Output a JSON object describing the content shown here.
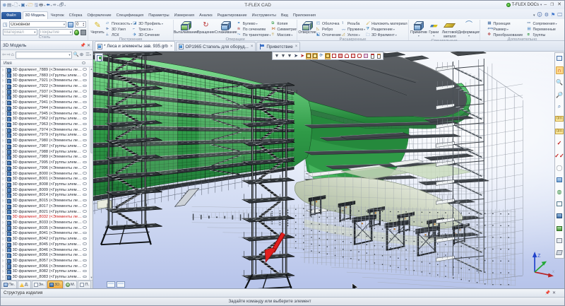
{
  "window": {
    "title": "T-FLEX CAD",
    "docs_button": "T-FLEX DOCs",
    "controls": {
      "minimize": "–",
      "maximize": "❐",
      "close": "✕"
    }
  },
  "quick_access": {
    "icons": [
      "app-logo",
      "menu",
      "new-document",
      "new-3d-document",
      "open-folder",
      "save",
      "print",
      "undo",
      "redo",
      "preview"
    ]
  },
  "tabs": {
    "items": [
      {
        "label": "Файл",
        "kind": "file"
      },
      {
        "label": "3D Модель",
        "active": true
      },
      {
        "label": "Чертеж"
      },
      {
        "label": "Сборка"
      },
      {
        "label": "Оформление"
      },
      {
        "label": "Спецификация"
      },
      {
        "label": "Параметры"
      },
      {
        "label": "Измерения"
      },
      {
        "label": "Анализ"
      },
      {
        "label": "Редактирование"
      },
      {
        "label": "Инструменты"
      },
      {
        "label": "Вид"
      },
      {
        "label": "Приложения"
      }
    ]
  },
  "ribbon": {
    "style": {
      "label": "Стиль",
      "style_value": "Основной",
      "layer_value": "0",
      "material_placeholder": "Материал",
      "coating_placeholder": "Покрытие"
    },
    "construct": {
      "label": "Построения",
      "big": "Чертить",
      "col1": [
        "Плоскость",
        "3D Узел",
        "ЛСК"
      ],
      "col2": [
        "3D Профиль",
        "Трасса",
        "3D Сечение"
      ]
    },
    "operations": {
      "label": "Операции",
      "big": [
        "Выталкивание",
        "Вращение",
        "Сглаживание"
      ],
      "col1": [
        "Булево",
        "По сечениям",
        "По траектории"
      ],
      "col2": [
        "Копия",
        "Симметрия",
        "Массив"
      ]
    },
    "extended": {
      "label": "Расширенные",
      "big": "Отверстие",
      "col1": [
        "Оболочка",
        "Ребро",
        "Отсечение"
      ],
      "col2": [
        "Резьба",
        "Пружина",
        "Уклон"
      ],
      "col3": [
        "Наложить материал",
        "Разделение",
        "3D Фрагмент"
      ]
    },
    "special": {
      "label": "Специальные",
      "big": [
        "Примитив",
        "Грани",
        "Листовой металл",
        "Деформация"
      ]
    },
    "additional": {
      "label": "Дополнительно",
      "col1": [
        "Проекция",
        "Размер",
        "Преобразование"
      ],
      "col2": [
        "Сопряжения",
        "Переменные",
        "Группы"
      ]
    }
  },
  "left_panel": {
    "title": "3D Модель",
    "column_header": "Имя",
    "search_value": "",
    "tree": [
      {
        "label": "3D фрагмент_7889 (<Элементы лесов>Сто..."
      },
      {
        "label": "3D фрагмент_7883 (<Группы элементов>..."
      },
      {
        "label": "3D фрагмент_7921 (<Элементы лесов>Сто..."
      },
      {
        "label": "3D фрагмент_7922 (<Элементы лесов>Сто..."
      },
      {
        "label": "3D фрагмент_7937 (<Элементы лесов>Сто..."
      },
      {
        "label": "3D фрагмент_7940 (<Элементы лесов>Сто..."
      },
      {
        "label": "3D фрагмент_7941 (<Элементы лесов>Сто..."
      },
      {
        "label": "3D фрагмент_7944 (<Элементы лесов>Сто..."
      },
      {
        "label": "3D фрагмент_7945 (<Элементы лесов>Сто..."
      },
      {
        "label": "3D фрагмент_7962 (<Группы элементов>..."
      },
      {
        "label": "3D фрагмент_7963 (<Элементы лесов>Тро..."
      },
      {
        "label": "3D фрагмент_7974 (<Элементы лесов>Сто..."
      },
      {
        "label": "3D фрагмент_7979 (<Группы элементов>..."
      },
      {
        "label": "3D фрагмент_7980 (<Элементы лесов>Сто..."
      },
      {
        "label": "3D фрагмент_7987 (<Группы элементов>..."
      },
      {
        "label": "3D фрагмент_7988 (<Группы элементов>..."
      },
      {
        "label": "3D фрагмент_7989 (<Элементы лесов>Сто..."
      },
      {
        "label": "3D фрагмент_7995 (<Группы элементов>..."
      },
      {
        "label": "3D фрагмент_7996 (<Элементы лесов>Кон..."
      },
      {
        "label": "3D фрагмент_8000 (<Элементы лесов>Кон..."
      },
      {
        "label": "3D фрагмент_8001 (<Элементы лесов>Сто..."
      },
      {
        "label": "3D фрагмент_8008 (<Группы элементов>..."
      },
      {
        "label": "3D фрагмент_8009 (<Группы элементов>..."
      },
      {
        "label": "3D фрагмент_8014 (<Группы элементов>..."
      },
      {
        "label": "3D фрагмент_8015 (<Элементы лесов>Кон..."
      },
      {
        "label": "3D фрагмент_8017 (<Элементы лесов>Сто..."
      },
      {
        "label": "3D фрагмент_8021 (<Группы элементов>..."
      },
      {
        "label": "3D фрагмент_8032 (<Элементы лесов>Тра...",
        "state": "red"
      },
      {
        "label": "3D фрагмент_8033 (<Элементы лесов>Тра..."
      },
      {
        "label": "3D фрагмент_8035 (<Элементы лесов>Сто..."
      },
      {
        "label": "3D фрагмент_8041 (<Элементы лесов>Сто..."
      },
      {
        "label": "3D фрагмент_8042 (<Группы элементов>..."
      },
      {
        "label": "3D фрагмент_8045 (<Группы элементов>..."
      },
      {
        "label": "3D фрагмент_8046 (<Элементы лесов>Тра..."
      },
      {
        "label": "3D фрагмент_8056 (<Элементы лесов>Сто..."
      },
      {
        "label": "3D фрагмент_8057 (<Элементы лесов>Сто..."
      },
      {
        "label": "3D фрагмент_8066 (<Элементы лесов>Тра..."
      },
      {
        "label": "3D фрагмент_8082 (<Группы элементов>..."
      },
      {
        "label": "3D фрагмент_8083 (<Группы элементов>..."
      }
    ],
    "bottom_tabs": [
      {
        "label": "Пе."
      },
      {
        "label": "Д."
      },
      {
        "label": "Зн."
      },
      {
        "label": "3D.",
        "active": true
      },
      {
        "label": "М."
      },
      {
        "label": "П."
      }
    ]
  },
  "document_tabs": [
    {
      "label": "* Леса и элементы зав. 935.grb",
      "close": "×",
      "active": true,
      "icon": "document"
    },
    {
      "label": "ОР1965 Стапель для оборуд...",
      "close": "×",
      "icon": "document"
    },
    {
      "label": "Приветствие",
      "close": "×",
      "icon": "flag"
    }
  ],
  "viewport": {
    "triad": {
      "z": "Z",
      "x": "x",
      "y": "y"
    },
    "colors": {
      "hull_green": "#2f9a47",
      "deck_gray": "#4b5055",
      "selection_red": "#e21f1f",
      "sky_bottom": "#b6c3ea"
    },
    "selection_toolbar_icons": [
      "filter-icon",
      "filter-box-icon",
      "filter-list-icon",
      "select-arrow-icon",
      "select-clear-icon",
      "select-vertex-icon",
      "select-edge-icon",
      "select-axis-icon",
      "select-face-icon",
      "select-body-icon",
      "select-solid-icon",
      "select-cylinder-icon",
      "select-box2-icon",
      "select-cyl2-icon",
      "select-part-icon",
      "select-doc-icon",
      "select-doc2-icon"
    ],
    "view_toolbar_icons": [
      "window-layout-icon",
      "magnet-icon",
      "zoom-in-icon",
      "zoom-out-icon",
      "zoom-window-icon",
      "pan-icon",
      "rotate-view-icon",
      "apply-icon",
      "apply-all-icon",
      "cancel-icon",
      "render-mode-icon",
      "globe-icon",
      "wireframe-icon",
      "shaded-icon",
      "shaded-edges-icon",
      "section-view-icon",
      "perspective-icon"
    ]
  },
  "structure_bar": {
    "label": "Структура изделия"
  },
  "status_bar": {
    "prompt": "Задайте команду или выберите элемент"
  }
}
